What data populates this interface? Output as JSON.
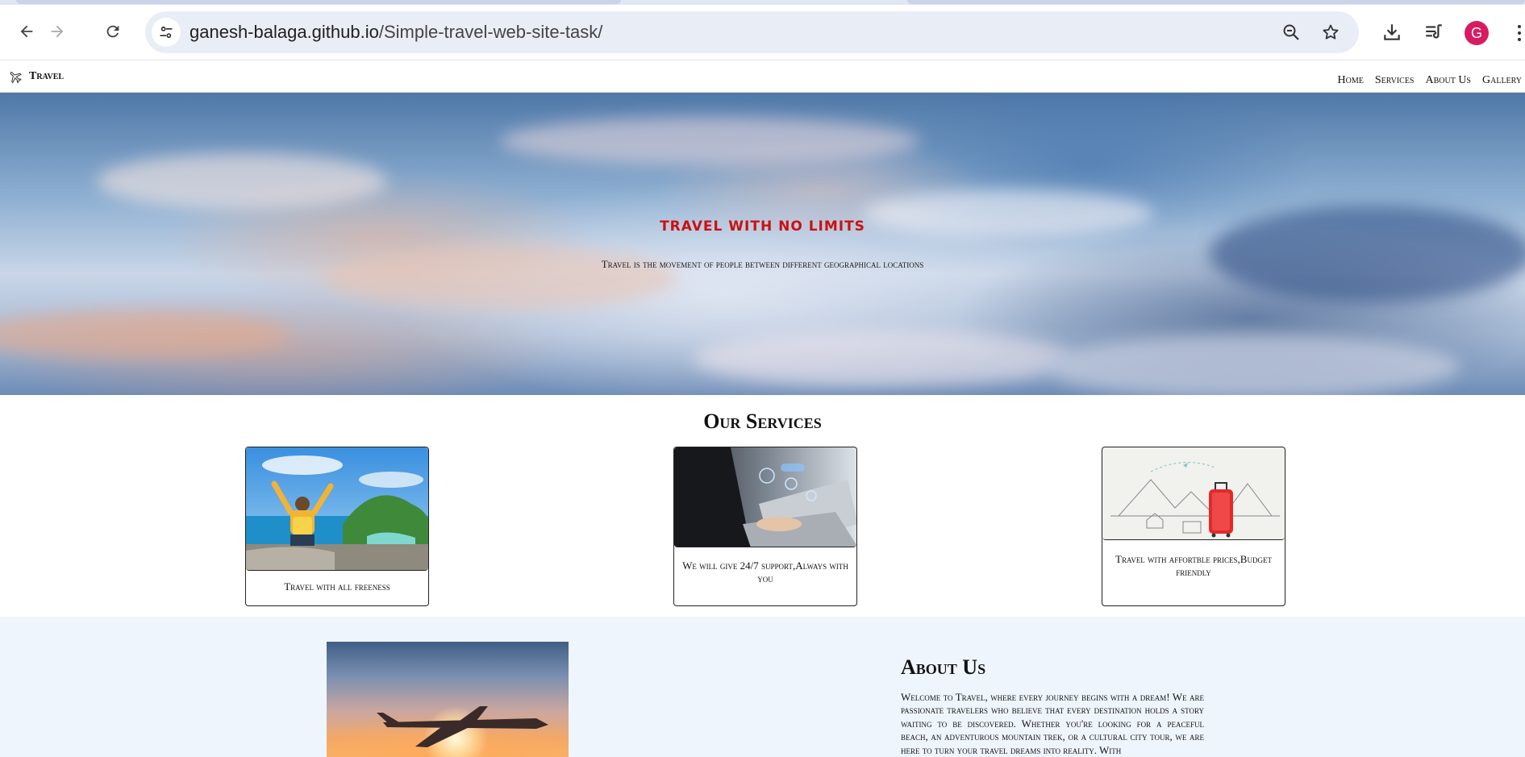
{
  "browser": {
    "url_domain": "ganesh-balaga.github.io",
    "url_path": "/Simple-travel-web-site-task/",
    "profile_initial": "G",
    "profile_color": "#d81b60"
  },
  "site": {
    "brand": "Travel",
    "nav": [
      "Home",
      "Services",
      "About Us",
      "Gallery"
    ]
  },
  "hero": {
    "title": "Travel with no limits",
    "subtitle": "Travel is the movement of people between different geographical locations",
    "title_color": "#cc1010"
  },
  "services": {
    "title": "Our Services",
    "cards": [
      {
        "text": "Travel with all freeness"
      },
      {
        "text": "We will give 24/7 support,Always with you"
      },
      {
        "text": "Travel with affortble prices,Budget friendly"
      }
    ]
  },
  "about": {
    "title": "About Us",
    "text": "Welcome to Travel, where every journey begins with a dream! We are passionate travelers who believe that every destination holds a story waiting to be discovered. Whether you're looking for a peaceful beach, an adventurous mountain trek, or a cultural city tour, we are here to turn your travel dreams into reality. With"
  }
}
